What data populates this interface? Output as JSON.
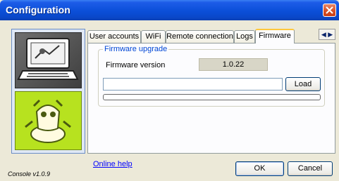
{
  "window": {
    "title": "Configuration"
  },
  "tabs": [
    {
      "label": "User accounts",
      "active": false
    },
    {
      "label": "WiFi",
      "active": false
    },
    {
      "label": "Remote connection",
      "active": false
    },
    {
      "label": "Logs",
      "active": false
    },
    {
      "label": "Firmware",
      "active": true
    }
  ],
  "firmware": {
    "group_title": "Firmware upgrade",
    "version_label": "Firmware version",
    "version_value": "1.0.22",
    "file_path": "",
    "load_label": "Load",
    "progress": 0
  },
  "footer": {
    "help_link": "Online help",
    "ok_label": "OK",
    "cancel_label": "Cancel",
    "version_text": "Console v1.0.9"
  },
  "colors": {
    "titlebar": "#0b4fd8",
    "close": "#d9552b",
    "robot_tile": "#b7e21f",
    "active_tab_accent": "#ffc83c",
    "link": "#0000ff"
  },
  "icons": [
    "close-icon",
    "console-laptop-icon",
    "robot-icon",
    "tab-scroll-left-icon",
    "tab-scroll-right-icon"
  ]
}
